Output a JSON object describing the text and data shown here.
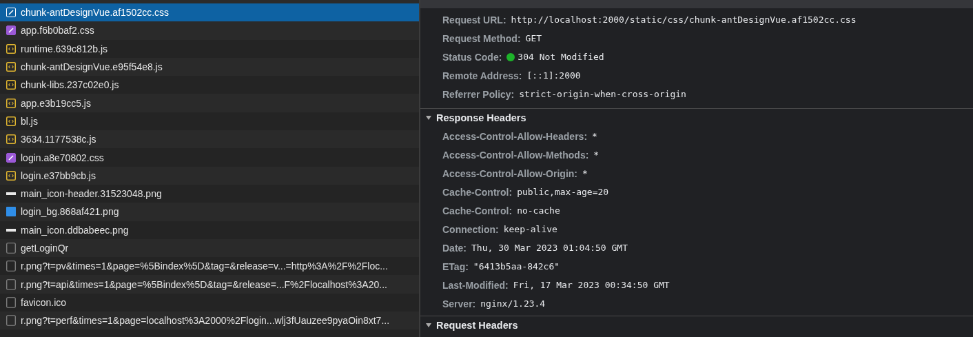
{
  "requests": [
    {
      "name": "chunk-antDesignVue.af1502cc.css",
      "kind": "stylesheet",
      "selected": true
    },
    {
      "name": "app.f6b0baf2.css",
      "kind": "stylesheet",
      "selected": false
    },
    {
      "name": "runtime.639c812b.js",
      "kind": "script",
      "selected": false
    },
    {
      "name": "chunk-antDesignVue.e95f54e8.js",
      "kind": "script",
      "selected": false
    },
    {
      "name": "chunk-libs.237c02e0.js",
      "kind": "script",
      "selected": false
    },
    {
      "name": "app.e3b19cc5.js",
      "kind": "script",
      "selected": false
    },
    {
      "name": "bl.js",
      "kind": "script",
      "selected": false
    },
    {
      "name": "3634.1177538c.js",
      "kind": "script",
      "selected": false
    },
    {
      "name": "login.a8e70802.css",
      "kind": "stylesheet",
      "selected": false
    },
    {
      "name": "login.e37bb9cb.js",
      "kind": "script",
      "selected": false
    },
    {
      "name": "main_icon-header.31523048.png",
      "kind": "image",
      "selected": false
    },
    {
      "name": "login_bg.868af421.png",
      "kind": "picture",
      "selected": false
    },
    {
      "name": "main_icon.ddbabeec.png",
      "kind": "image",
      "selected": false
    },
    {
      "name": "getLoginQr",
      "kind": "document",
      "selected": false
    },
    {
      "name": "r.png?t=pv&times=1&page=%5Bindex%5D&tag=&release=v...=http%3A%2F%2Floc...",
      "kind": "document",
      "selected": false
    },
    {
      "name": "r.png?t=api&times=1&page=%5Bindex%5D&tag=&release=...F%2Flocalhost%3A20...",
      "kind": "document",
      "selected": false
    },
    {
      "name": "favicon.ico",
      "kind": "document",
      "selected": false
    },
    {
      "name": "r.png?t=perf&times=1&page=localhost%3A2000%2Flogin...wlj3fUauzee9pyaOin8xt7...",
      "kind": "document",
      "selected": false
    }
  ],
  "general": {
    "rows": [
      {
        "label": "Request URL:",
        "value": "http://localhost:2000/static/css/chunk-antDesignVue.af1502cc.css",
        "kind": "text"
      },
      {
        "label": "Request Method:",
        "value": "GET",
        "kind": "text"
      },
      {
        "label": "Status Code:",
        "value": "304 Not Modified",
        "kind": "status"
      },
      {
        "label": "Remote Address:",
        "value": "[::1]:2000",
        "kind": "text"
      },
      {
        "label": "Referrer Policy:",
        "value": "strict-origin-when-cross-origin",
        "kind": "text"
      }
    ]
  },
  "response_headers": {
    "title": "Response Headers",
    "expanded": true,
    "rows": [
      {
        "label": "Access-Control-Allow-Headers:",
        "value": "*"
      },
      {
        "label": "Access-Control-Allow-Methods:",
        "value": "*"
      },
      {
        "label": "Access-Control-Allow-Origin:",
        "value": "*"
      },
      {
        "label": "Cache-Control:",
        "value": "public,max-age=20"
      },
      {
        "label": "Cache-Control:",
        "value": "no-cache"
      },
      {
        "label": "Connection:",
        "value": "keep-alive"
      },
      {
        "label": "Date:",
        "value": "Thu, 30 Mar 2023 01:04:50 GMT"
      },
      {
        "label": "ETag:",
        "value": "\"6413b5aa-842c6\""
      },
      {
        "label": "Last-Modified:",
        "value": "Fri, 17 Mar 2023 00:34:50 GMT"
      },
      {
        "label": "Server:",
        "value": "nginx/1.23.4"
      }
    ]
  },
  "request_headers": {
    "title": "Request Headers",
    "expanded": true
  }
}
